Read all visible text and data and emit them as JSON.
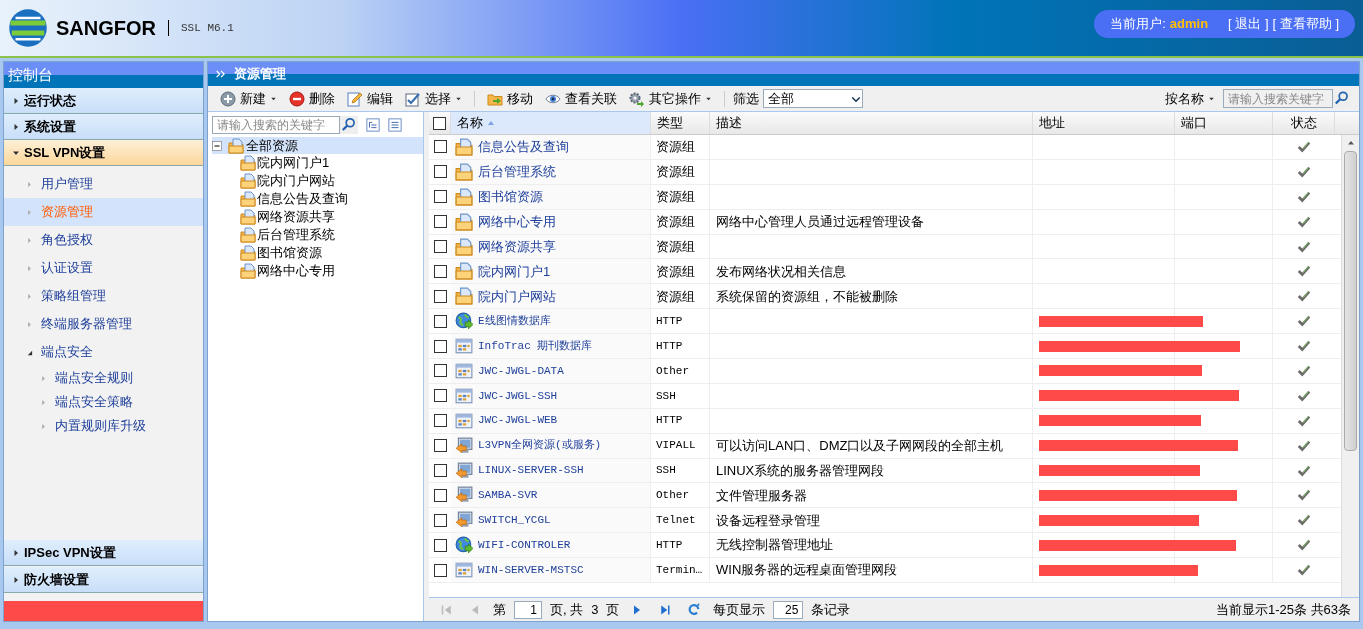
{
  "header": {
    "brand": "SANGFOR",
    "version": "SSL M6.1",
    "user_label": "当前用户:",
    "user": "admin",
    "links": [
      "[ 退出 ]",
      "[ 查看帮助 ]"
    ]
  },
  "sidebar": {
    "title": "控制台",
    "sections": [
      {
        "label": "运行状态",
        "expanded": false
      },
      {
        "label": "系统设置",
        "expanded": false
      },
      {
        "label": "SSL VPN设置",
        "expanded": true,
        "children": [
          {
            "label": "用户管理",
            "selected": false
          },
          {
            "label": "资源管理",
            "selected": true
          },
          {
            "label": "角色授权",
            "selected": false
          },
          {
            "label": "认证设置",
            "selected": false
          },
          {
            "label": "策略组管理",
            "selected": false
          },
          {
            "label": "终端服务器管理",
            "selected": false
          },
          {
            "label": "端点安全",
            "selected": false,
            "expanded": true,
            "children": [
              {
                "label": "端点安全规则",
                "selected": false
              },
              {
                "label": "端点安全策略",
                "selected": false
              },
              {
                "label": "内置规则库升级",
                "selected": false
              }
            ]
          }
        ]
      },
      {
        "label": "IPSec VPN设置",
        "expanded": false
      },
      {
        "label": "防火墙设置",
        "expanded": false
      }
    ]
  },
  "panel_title": "资源管理",
  "toolbar": [
    {
      "kind": "add",
      "label": "新建",
      "menu": true
    },
    {
      "kind": "delete",
      "label": "删除",
      "menu": false
    },
    {
      "kind": "edit",
      "label": "编辑",
      "menu": false
    },
    {
      "kind": "select",
      "label": "选择",
      "menu": true
    },
    {
      "kind": "move",
      "label": "移动",
      "menu": false
    },
    {
      "kind": "view",
      "label": "查看关联",
      "menu": false
    },
    {
      "kind": "other",
      "label": "其它操作",
      "menu": true
    }
  ],
  "filter": {
    "label": "筛选",
    "value": "全部"
  },
  "search": {
    "field": "按名称",
    "placeholder": "请输入搜索关键字"
  },
  "tree": {
    "placeholder": "请输入搜索的关键字",
    "root": {
      "label": "全部资源",
      "expanded": true,
      "selected": true,
      "children": [
        {
          "label": "院内网门户1"
        },
        {
          "label": "院内门户网站"
        },
        {
          "label": "信息公告及查询"
        },
        {
          "label": "网络资源共享"
        },
        {
          "label": "后台管理系统"
        },
        {
          "label": "图书馆资源"
        },
        {
          "label": "网络中心专用"
        }
      ]
    }
  },
  "table": {
    "select_all": false,
    "columns": [
      "名称",
      "类型",
      "描述",
      "地址",
      "端口",
      "状态"
    ],
    "rows": [
      {
        "kind": "group",
        "name": "信息公告及查询",
        "type": "资源组",
        "description": "",
        "redacted": false,
        "enabled": true,
        "checked": false
      },
      {
        "kind": "group",
        "name": "后台管理系统",
        "type": "资源组",
        "description": "",
        "redacted": false,
        "enabled": true,
        "checked": false
      },
      {
        "kind": "group",
        "name": "图书馆资源",
        "type": "资源组",
        "description": "",
        "redacted": false,
        "enabled": true,
        "checked": false
      },
      {
        "kind": "group",
        "name": "网络中心专用",
        "type": "资源组",
        "description": "网络中心管理人员通过远程管理设备",
        "redacted": false,
        "enabled": true,
        "checked": false
      },
      {
        "kind": "group",
        "name": "网络资源共享",
        "type": "资源组",
        "description": "",
        "redacted": false,
        "enabled": true,
        "checked": false
      },
      {
        "kind": "group",
        "name": "院内网门户1",
        "type": "资源组",
        "description": "发布网络状况相关信息",
        "redacted": false,
        "enabled": true,
        "checked": false
      },
      {
        "kind": "group",
        "name": "院内门户网站",
        "type": "资源组",
        "description": "系统保留的资源组，不能被删除",
        "redacted": false,
        "enabled": true,
        "checked": false
      },
      {
        "kind": "web",
        "name": "E线图情数据库",
        "type": "HTTP",
        "description": "",
        "redacted": true,
        "enabled": true,
        "checked": false
      },
      {
        "kind": "app",
        "name": "InfoTrac 期刊数据库",
        "type": "HTTP",
        "description": "",
        "redacted": true,
        "enabled": true,
        "checked": false
      },
      {
        "kind": "app",
        "name": "JWC-JWGL-DATA",
        "type": "Other",
        "description": "",
        "redacted": true,
        "enabled": true,
        "checked": false
      },
      {
        "kind": "app",
        "name": "JWC-JWGL-SSH",
        "type": "SSH",
        "description": "",
        "redacted": true,
        "enabled": true,
        "checked": false
      },
      {
        "kind": "app",
        "name": "JWC-JWGL-WEB",
        "type": "HTTP",
        "description": "",
        "redacted": true,
        "enabled": true,
        "checked": false
      },
      {
        "kind": "remote",
        "name": "L3VPN全网资源(或服务)",
        "type": "VIPALL",
        "description": "可以访问LAN口、DMZ口以及子网网段的全部主机",
        "redacted": true,
        "enabled": true,
        "checked": false
      },
      {
        "kind": "remote",
        "name": "LINUX-SERVER-SSH",
        "type": "SSH",
        "description": "LINUX系统的服务器管理网段",
        "redacted": true,
        "enabled": true,
        "checked": false
      },
      {
        "kind": "remote",
        "name": "SAMBA-SVR",
        "type": "Other",
        "description": "文件管理服务器",
        "redacted": true,
        "enabled": true,
        "checked": false
      },
      {
        "kind": "remote",
        "name": "SWITCH_YCGL",
        "type": "Telnet",
        "description": "设备远程登录管理",
        "redacted": true,
        "enabled": true,
        "checked": false
      },
      {
        "kind": "web",
        "name": "WIFI-CONTROLER",
        "type": "HTTP",
        "description": "无线控制器管理地址",
        "redacted": true,
        "enabled": true,
        "checked": false
      },
      {
        "kind": "app",
        "name": "WIN-SERVER-MSTSC",
        "type": "Termin…",
        "description": "WIN服务器的远程桌面管理网段",
        "redacted": true,
        "enabled": true,
        "checked": false
      }
    ]
  },
  "pager": {
    "page_prefix": "第",
    "page": "1",
    "page_mid": "页, 共",
    "pages": "3",
    "page_suffix": "页",
    "size_label": "每页显示",
    "size": "25",
    "size_suffix": "条记录",
    "summary": "当前显示1-25条 共63条"
  }
}
